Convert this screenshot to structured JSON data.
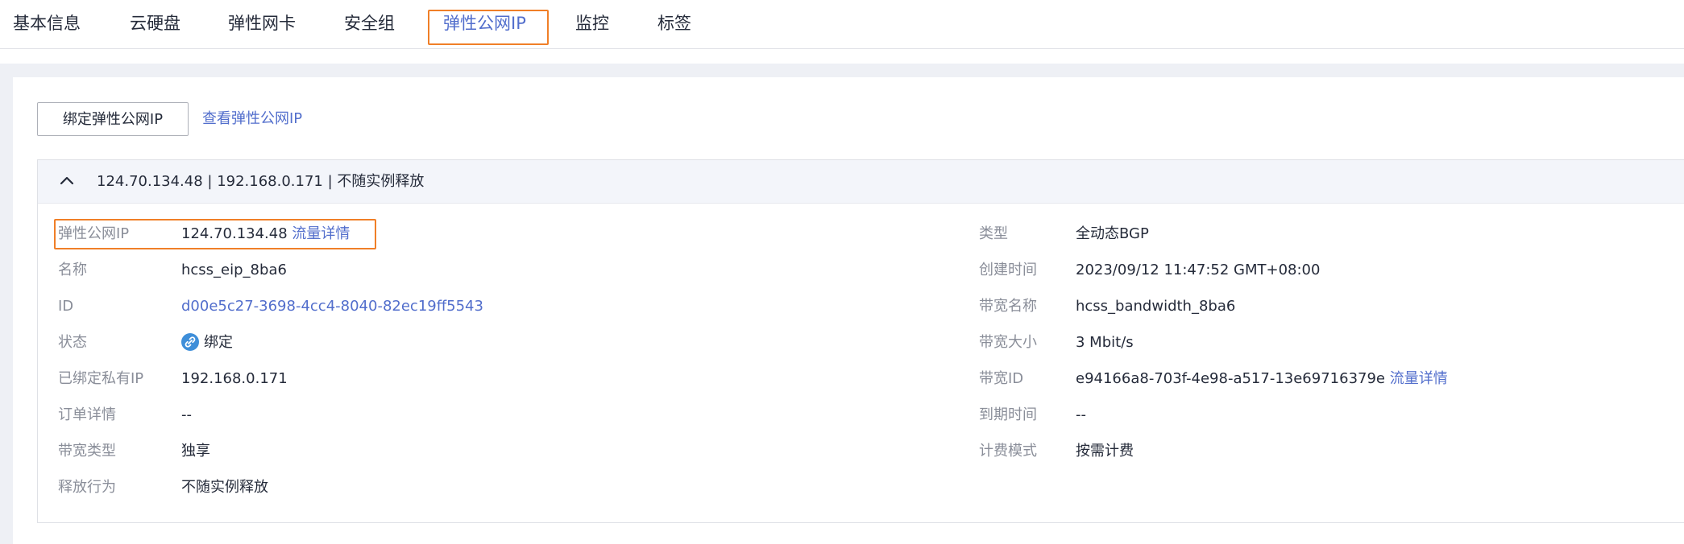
{
  "tabs": [
    {
      "label": "基本信息"
    },
    {
      "label": "云硬盘"
    },
    {
      "label": "弹性网卡"
    },
    {
      "label": "安全组"
    },
    {
      "label": "弹性公网IP",
      "active": true
    },
    {
      "label": "监控"
    },
    {
      "label": "标签"
    }
  ],
  "toolbar": {
    "bind_button": "绑定弹性公网IP",
    "view_link": "查看弹性公网IP"
  },
  "card": {
    "header": "124.70.134.48 | 192.168.0.171 | 不随实例释放",
    "left": [
      {
        "label": "弹性公网IP",
        "value": "124.70.134.48",
        "link": "流量详情"
      },
      {
        "label": "名称",
        "value": "hcss_eip_8ba6"
      },
      {
        "label": "ID",
        "value": "d00e5c27-3698-4cc4-8040-82ec19ff5543"
      },
      {
        "label": "状态",
        "value": "绑定"
      },
      {
        "label": "已绑定私有IP",
        "value": "192.168.0.171"
      },
      {
        "label": "订单详情",
        "value": "--"
      },
      {
        "label": "带宽类型",
        "value": "独享"
      },
      {
        "label": "释放行为",
        "value": "不随实例释放"
      }
    ],
    "right": [
      {
        "label": "类型",
        "value": "全动态BGP"
      },
      {
        "label": "创建时间",
        "value": "2023/09/12 11:47:52 GMT+08:00"
      },
      {
        "label": "带宽名称",
        "value": "hcss_bandwidth_8ba6"
      },
      {
        "label": "带宽大小",
        "value": "3 Mbit/s"
      },
      {
        "label": "带宽ID",
        "value": "e94166a8-703f-4e98-a517-13e69716379e",
        "link": "流量详情"
      },
      {
        "label": "到期时间",
        "value": "--"
      },
      {
        "label": "计费模式",
        "value": "按需计费"
      }
    ]
  },
  "colors": {
    "accent": "#526ecc",
    "highlight": "#f07f28",
    "status_icon": "#3e8ed9"
  }
}
